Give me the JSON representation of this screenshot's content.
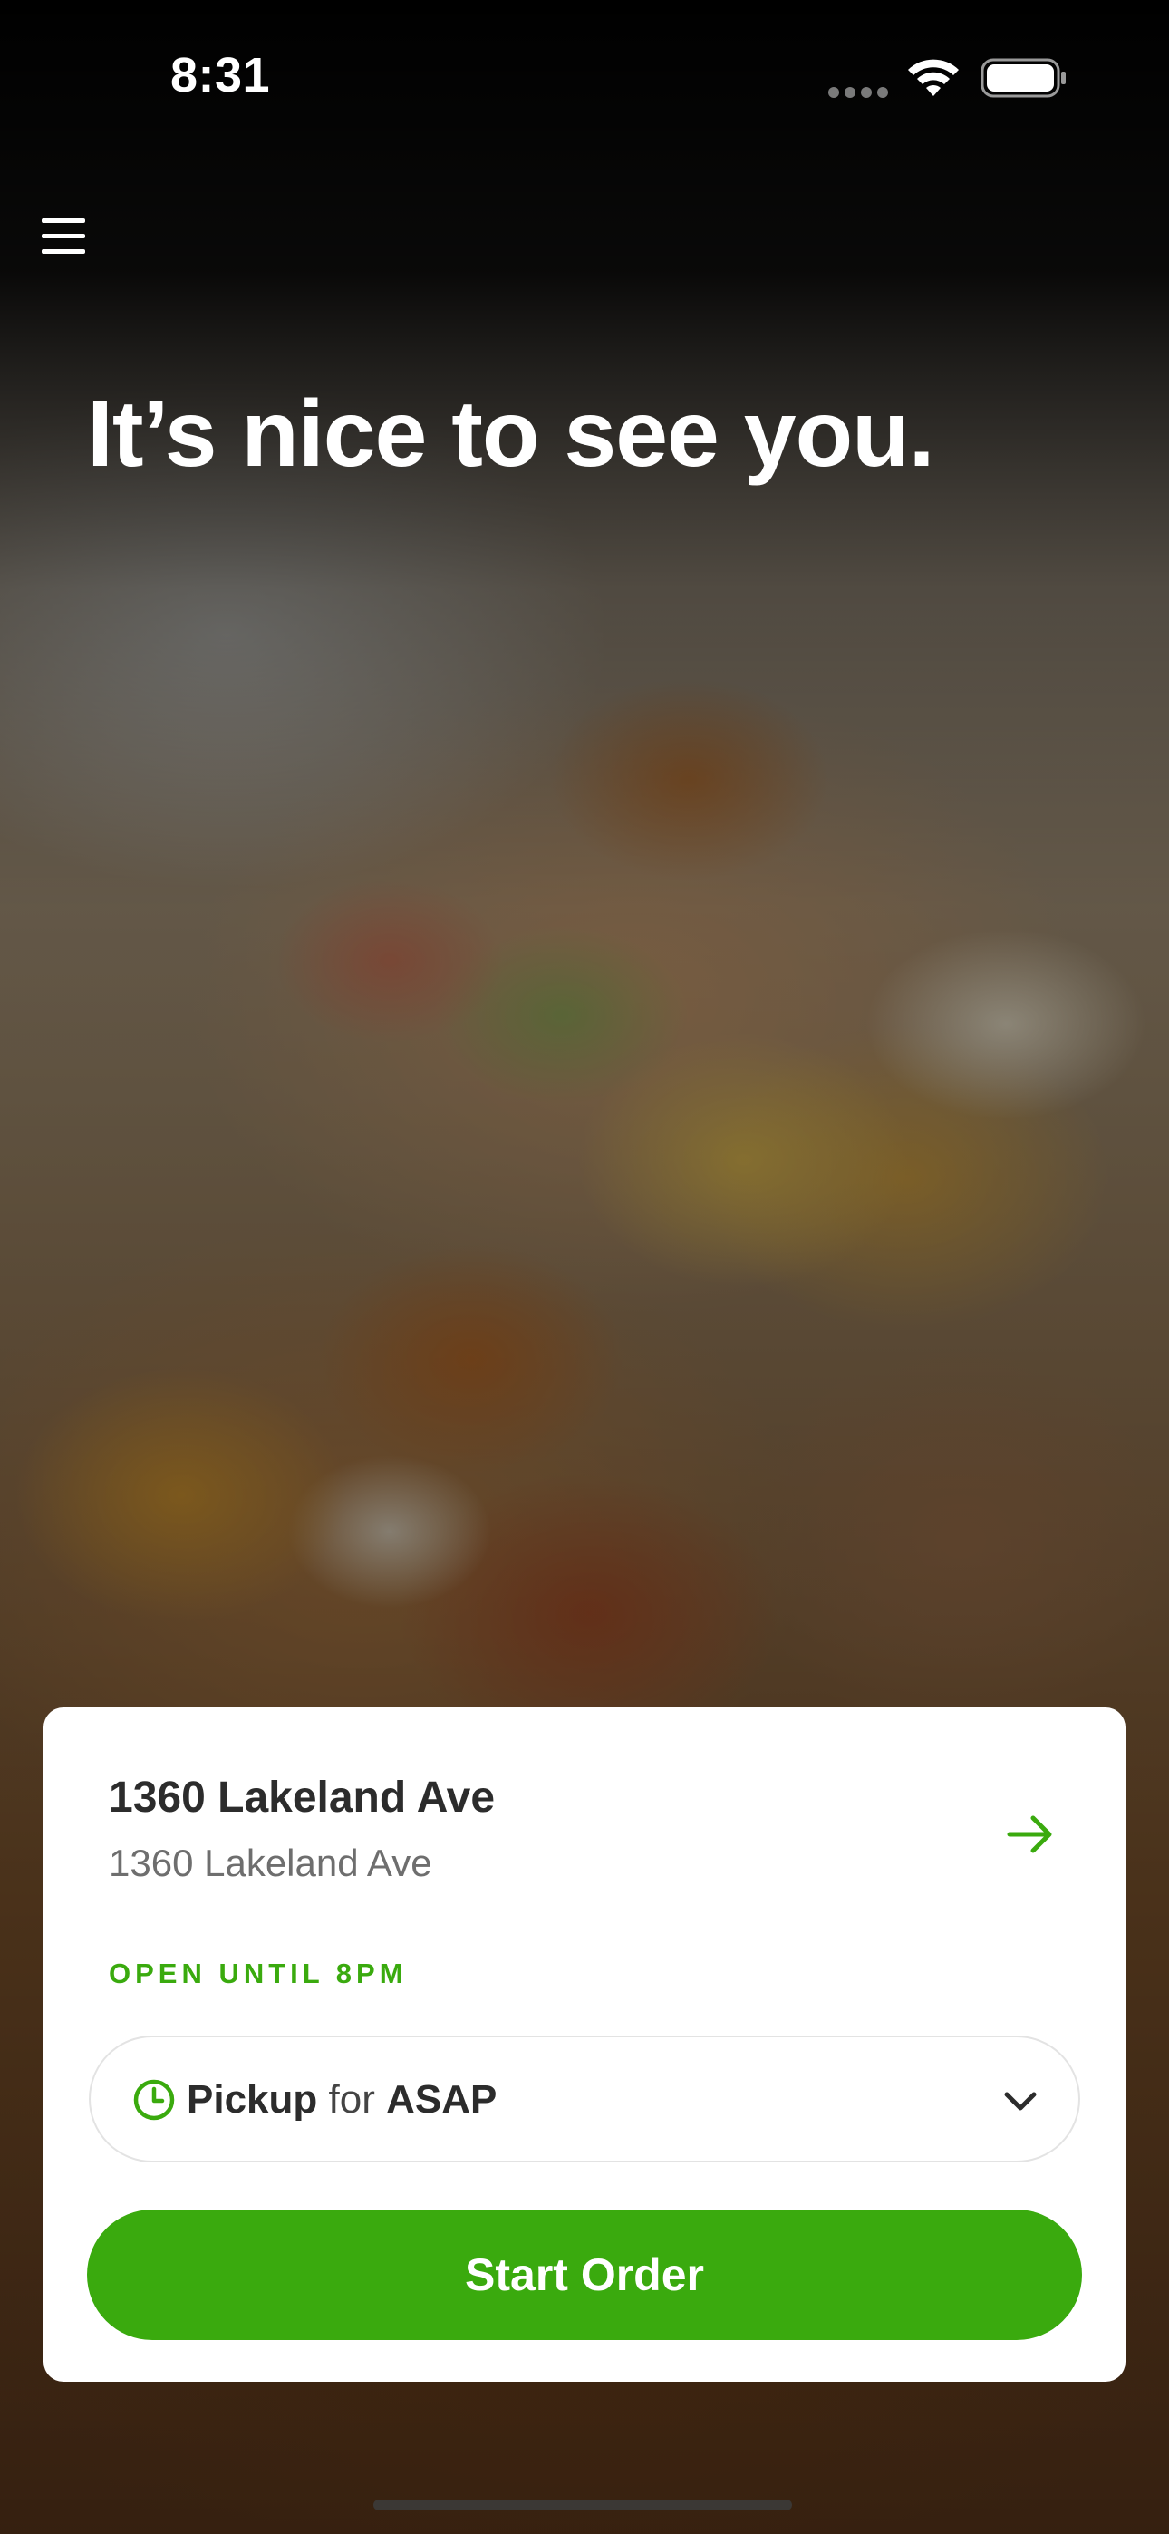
{
  "status_bar": {
    "time": "8:31"
  },
  "header": {
    "menu_icon": "hamburger-menu-icon"
  },
  "hero": {
    "greeting": "It’s nice to see you."
  },
  "store_card": {
    "store_name": "1360 Lakeland Ave",
    "store_address": "1360 Lakeland Ave",
    "hours": "OPEN UNTIL 8PM",
    "arrow_icon": "arrow-right-icon",
    "pickup": {
      "method": "Pickup",
      "connector": "for",
      "time": "ASAP",
      "clock_icon": "clock-icon",
      "chevron_icon": "chevron-down-icon"
    },
    "start_order_label": "Start Order"
  },
  "colors": {
    "accent": "#3aaa0e",
    "card_background": "#ffffff",
    "text_primary": "#2c2c2c",
    "text_secondary": "#6e6e6e"
  }
}
